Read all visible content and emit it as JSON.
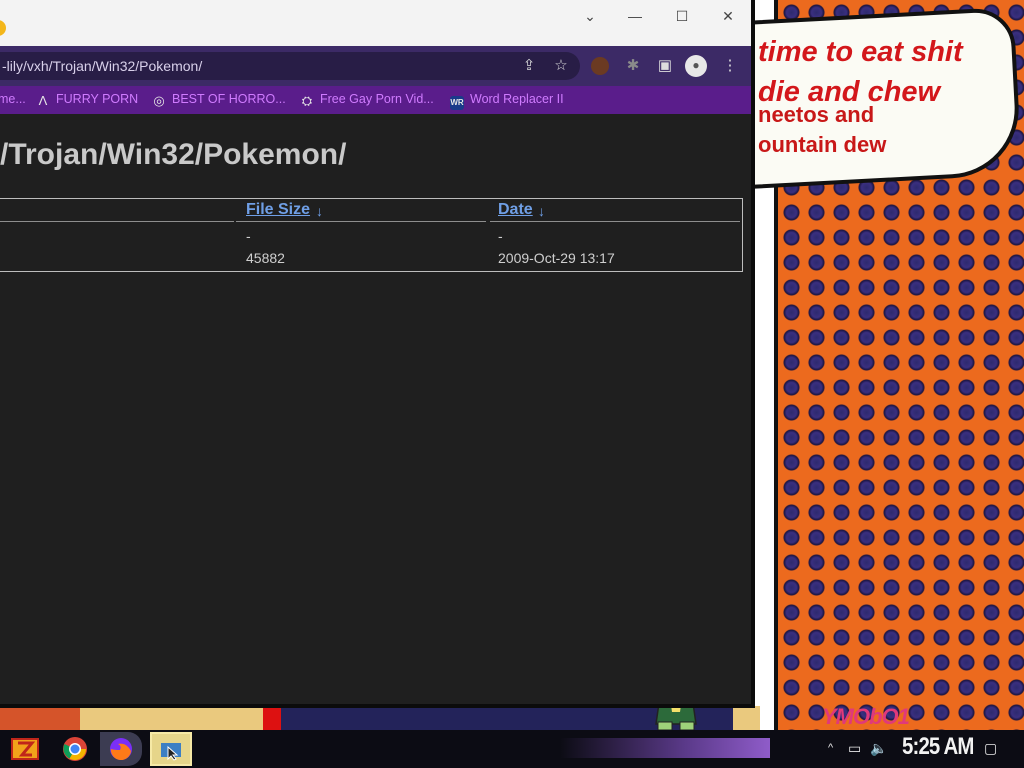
{
  "browser": {
    "address_bar": {
      "url": "-lily/vxh/Trojan/Win32/Pokemon/"
    },
    "window_controls": {
      "chevron": "⌄",
      "minimize": "—",
      "maximize": "☐",
      "close": "✕"
    },
    "toolbar_icons": {
      "share": "⇪",
      "star": "☆",
      "extension": "✎",
      "puzzle": "✱",
      "sidepanel": "▣",
      "profile": "●",
      "menu": "⋮"
    },
    "bookmarks": [
      {
        "label": "me...",
        "icon": ""
      },
      {
        "label": "FURRY PORN",
        "icon": "Λ"
      },
      {
        "label": "BEST OF HORRO...",
        "icon": "◎"
      },
      {
        "label": "Free Gay Porn Vid...",
        "icon": "⛭"
      },
      {
        "label": "Word Replacer II",
        "icon": "WR"
      }
    ]
  },
  "page": {
    "heading": "/Trojan/Win32/Pokemon/",
    "columns": [
      {
        "label": "File Size",
        "sort_arrow": "↓"
      },
      {
        "label": "Date",
        "sort_arrow": "↓"
      }
    ],
    "rows": [
      {
        "size": "-",
        "date": "-"
      },
      {
        "size": "45882",
        "date": "2009-Oct-29 13:17"
      }
    ]
  },
  "wallpaper": {
    "speech_bubble": [
      "time to eat shit",
      "die and chew",
      "neetos and",
      "ountain dew"
    ],
    "signature": "YMObO1"
  },
  "taskbar": {
    "clock": "5:25 AM",
    "tray": {
      "chevron": "^",
      "network": "▭",
      "volume": "🔈",
      "notification": "▢"
    }
  },
  "colors": {
    "page_bg": "#1f1f1f",
    "link": "#6f9fe6",
    "bookmark_text": "#d07bff",
    "bookmark_bar": "#5a1d8b",
    "toolbar": "#3c2a66",
    "wallpaper_orange": "#ec6a1e",
    "bubble_text": "#d3171b"
  }
}
